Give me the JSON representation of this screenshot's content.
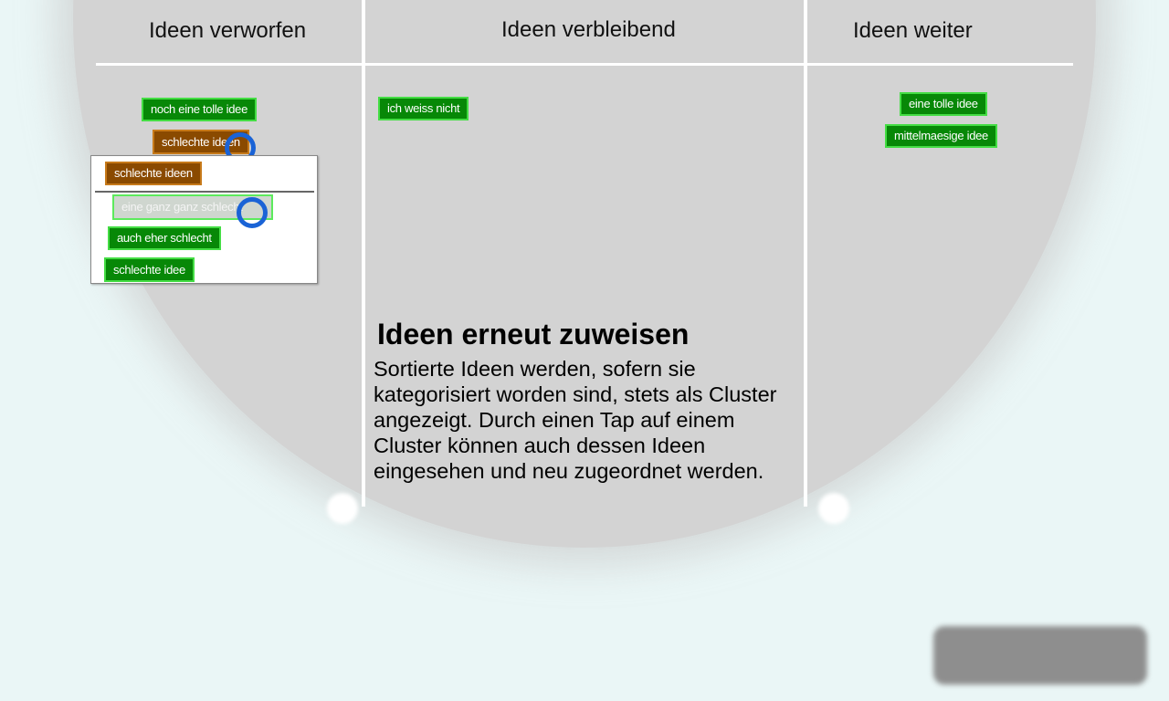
{
  "columns": {
    "discarded": {
      "title": "Ideen verworfen"
    },
    "remaining": {
      "title": "Ideen verbleibend"
    },
    "next": {
      "title": "Ideen weiter"
    }
  },
  "chips": {
    "discarded": [
      {
        "label": "noch eine tolle idee",
        "style": "green"
      },
      {
        "label": "schlechte ideen",
        "style": "brown"
      }
    ],
    "remaining": [
      {
        "label": "ich weiss nicht",
        "style": "green"
      }
    ],
    "next": [
      {
        "label": "eine tolle idee",
        "style": "green"
      },
      {
        "label": "mittelmaesige idee",
        "style": "green"
      }
    ]
  },
  "cluster_popup": {
    "header": "schlechte ideen",
    "items": [
      {
        "label": "eine ganz ganz schlecht",
        "state": "selected"
      },
      {
        "label": "auch eher schlecht"
      },
      {
        "label": "schlechte idee"
      }
    ]
  },
  "info": {
    "title": "Ideen erneut zuweisen",
    "body": "Sortierte Ideen werden, sofern sie kategorisiert worden sind, stets als Cluster angezeigt. Durch einen Tap auf einem Cluster können auch dessen Ideen eingesehen und neu zugeordnet werden."
  },
  "colors": {
    "chip_green": "#078807",
    "chip_brown": "#8a4a00",
    "touch_ring": "#1a63d6",
    "spotlight": "#d3d3d3",
    "background": "#eaf6f6"
  }
}
